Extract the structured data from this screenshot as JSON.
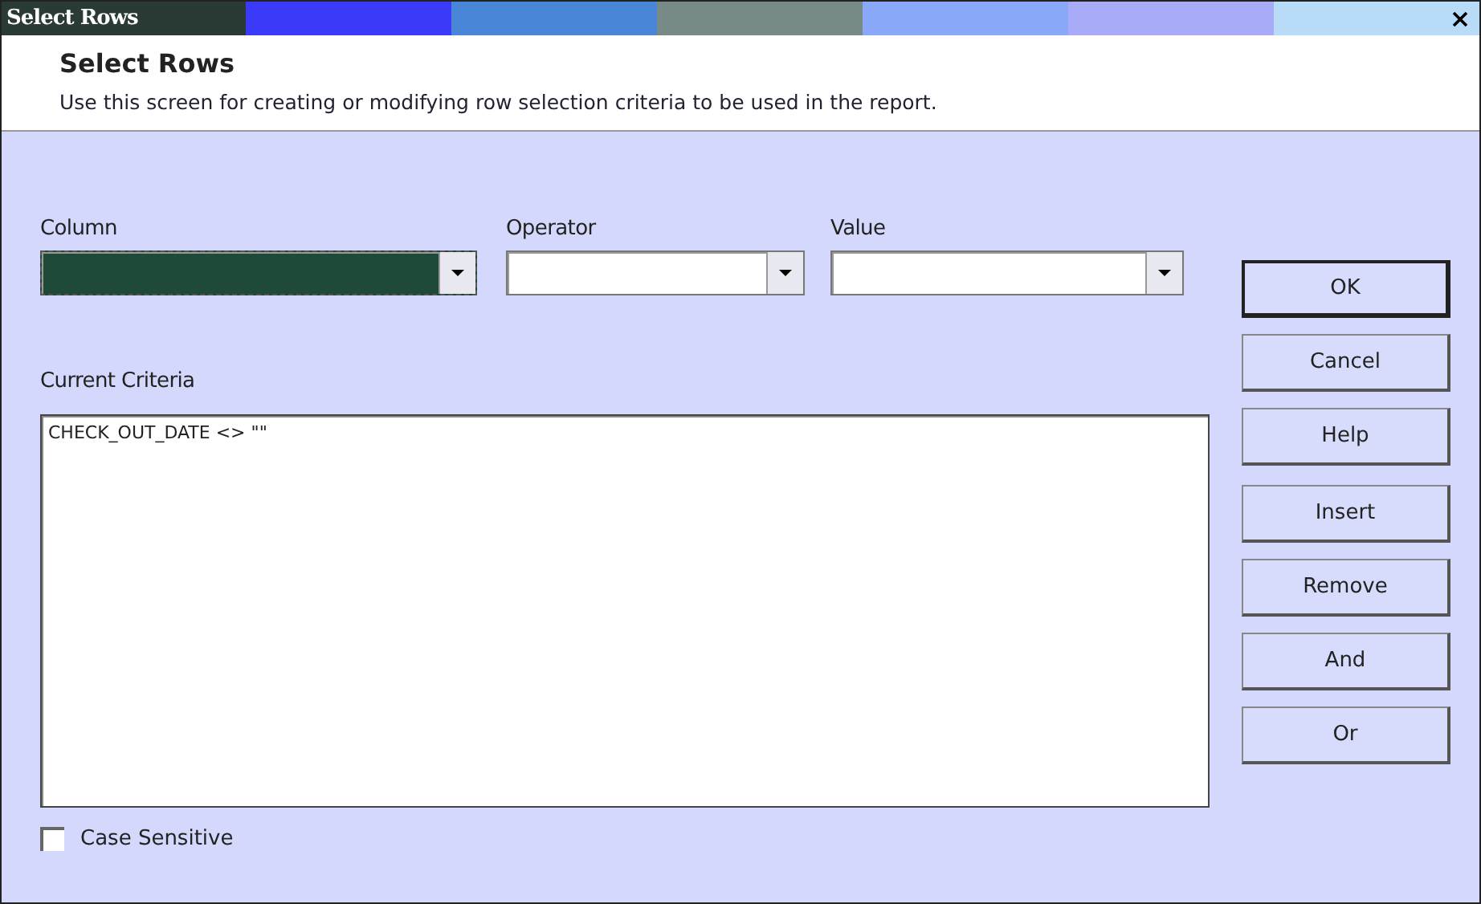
{
  "window": {
    "title": "Select Rows"
  },
  "header": {
    "title": "Select Rows",
    "description": "Use this screen for creating or modifying row selection criteria to be used in the report."
  },
  "fields": [
    {
      "label": "Column",
      "highlighted": true
    },
    {
      "label": "Operator",
      "highlighted": false
    },
    {
      "label": "Value",
      "highlighted": false
    }
  ],
  "criteria": {
    "label": "Current Criteria",
    "text": "CHECK_OUT_DATE <> \"\""
  },
  "case_sensitive": {
    "label": "Case Sensitive",
    "checked": false
  },
  "buttons": [
    {
      "label": "OK",
      "default": true
    },
    {
      "label": "Cancel",
      "default": false
    },
    {
      "label": "Help",
      "default": false
    },
    {
      "label": "Insert",
      "default": false
    },
    {
      "label": "Remove",
      "default": false
    },
    {
      "label": "And",
      "default": false
    },
    {
      "label": "Or",
      "default": false
    }
  ]
}
